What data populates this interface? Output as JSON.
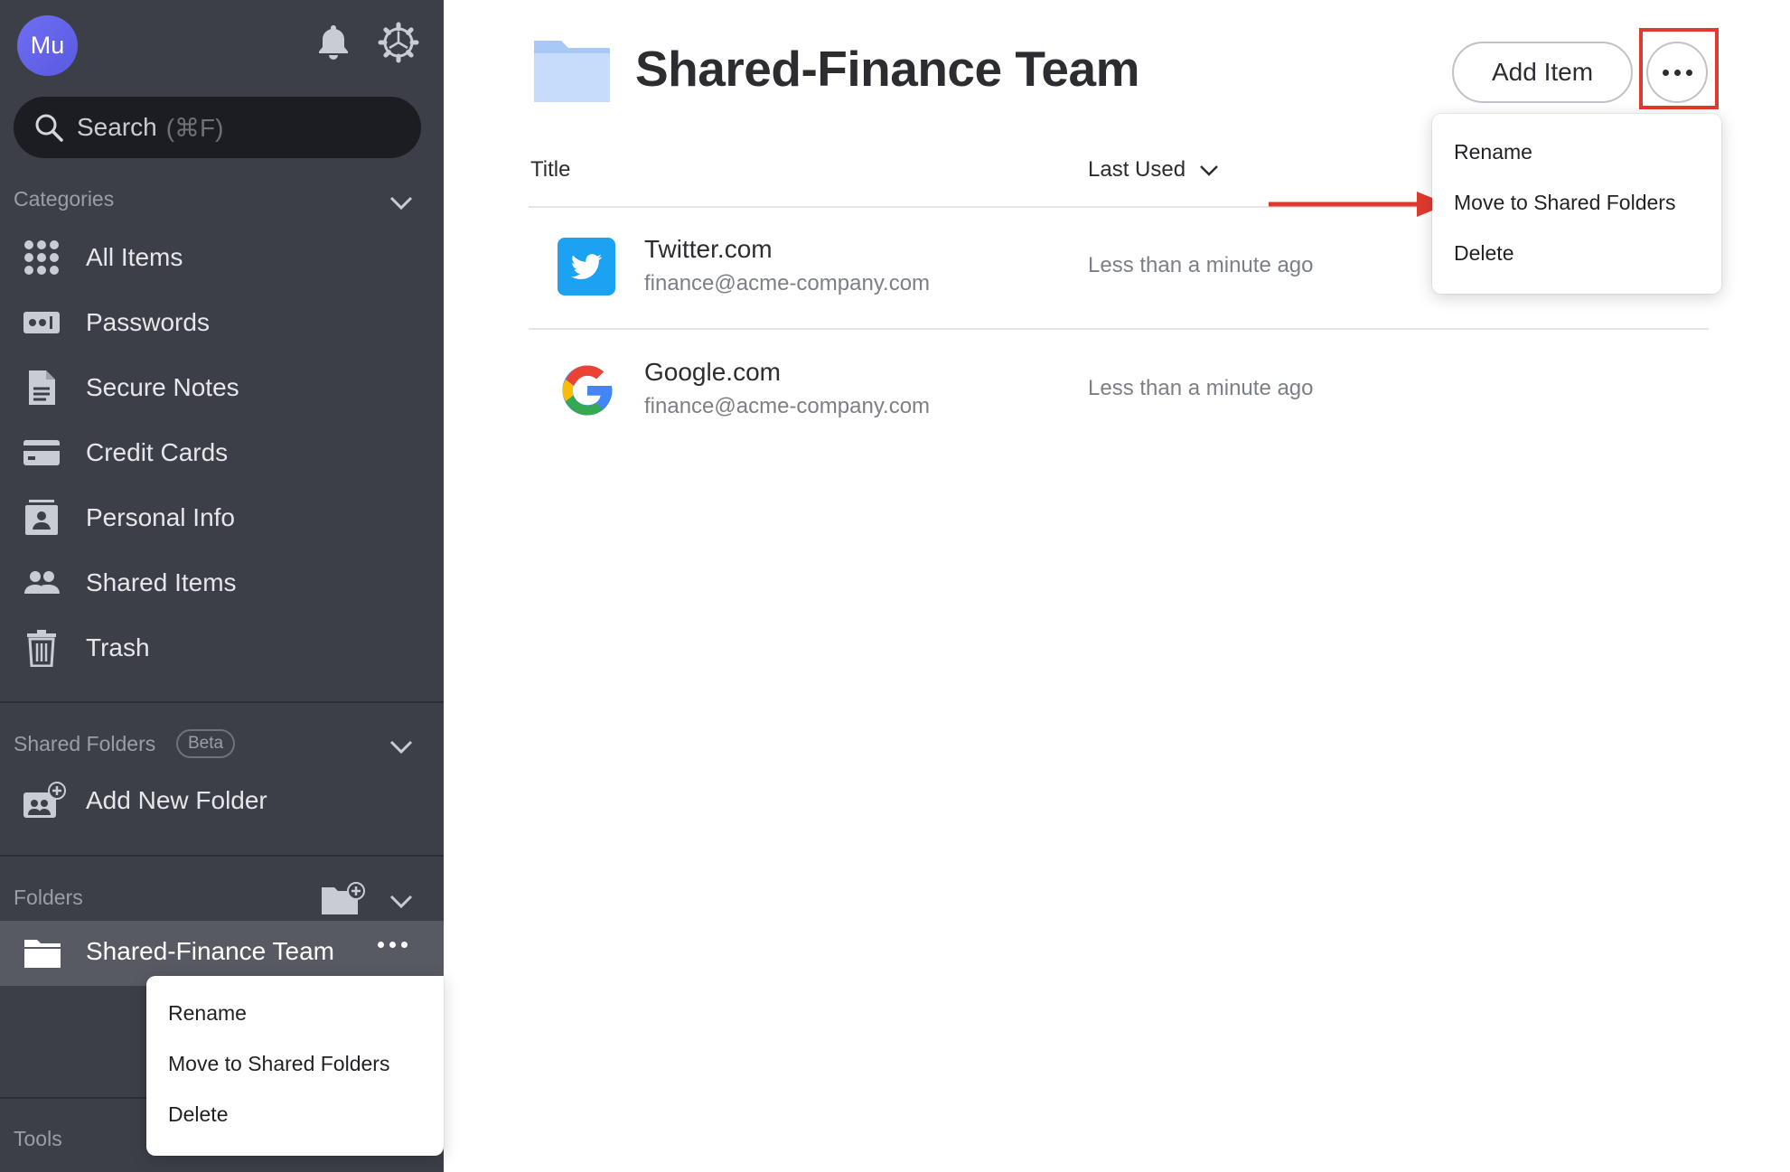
{
  "sidebar": {
    "avatar_initials": "Mu",
    "search": {
      "placeholder": "Search",
      "shortcut": "(⌘F)"
    },
    "categories_label": "Categories",
    "categories": [
      {
        "label": "All Items",
        "icon": "grid-icon"
      },
      {
        "label": "Passwords",
        "icon": "password-icon"
      },
      {
        "label": "Secure Notes",
        "icon": "note-icon"
      },
      {
        "label": "Credit Cards",
        "icon": "credit-card-icon"
      },
      {
        "label": "Personal Info",
        "icon": "id-card-icon"
      },
      {
        "label": "Shared Items",
        "icon": "people-icon"
      },
      {
        "label": "Trash",
        "icon": "trash-icon"
      }
    ],
    "shared_folders_label": "Shared Folders",
    "beta_badge": "Beta",
    "add_new_folder": "Add New Folder",
    "folders_label": "Folders",
    "selected_folder": "Shared-Finance Team",
    "tools_label": "Tools"
  },
  "sidebar_menu": {
    "items": [
      "Rename",
      "Move to Shared Folders",
      "Delete"
    ]
  },
  "main": {
    "title": "Shared-Finance Team",
    "add_item_label": "Add Item",
    "columns": {
      "title": "Title",
      "last_used": "Last Used"
    },
    "rows": [
      {
        "title": "Twitter.com",
        "username": "finance@acme-company.com",
        "last_used": "Less than a minute ago",
        "icon": "twitter-icon"
      },
      {
        "title": "Google.com",
        "username": "finance@acme-company.com",
        "last_used": "Less than a minute ago",
        "icon": "google-icon"
      }
    ]
  },
  "header_menu": {
    "items": [
      "Rename",
      "Move to Shared Folders",
      "Delete"
    ]
  },
  "colors": {
    "sidebar_bg": "#3c3f47",
    "highlight": "#e03a2f",
    "avatar": "#6767ee",
    "folder": "#a9c8f5"
  }
}
